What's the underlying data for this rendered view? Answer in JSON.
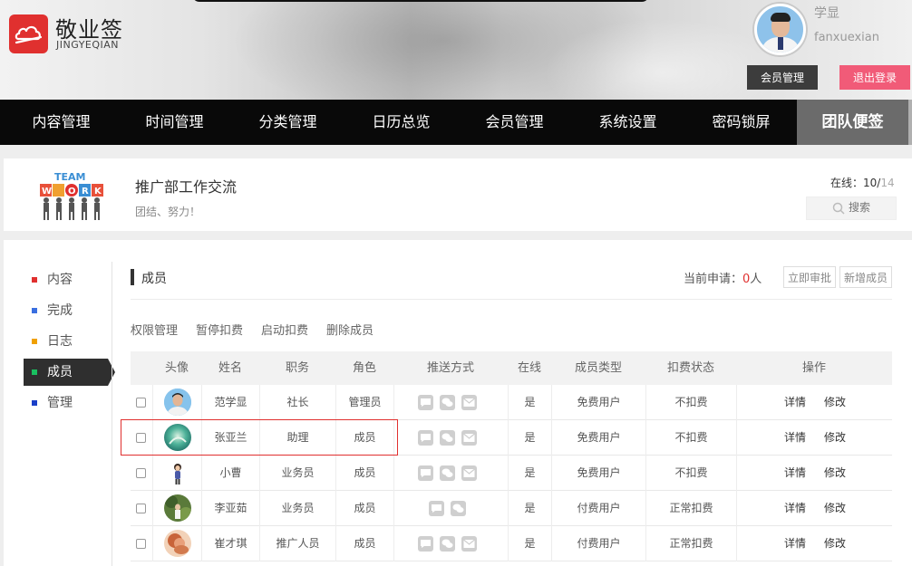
{
  "brand": {
    "name": "敬业签",
    "sub": "JINGYEQIAN"
  },
  "user": {
    "name": "学显",
    "id": "fanxuexian",
    "member_btn": "会员管理",
    "logout_btn": "退出登录"
  },
  "nav": [
    "内容管理",
    "时间管理",
    "分类管理",
    "日历总览",
    "会员管理",
    "系统设置",
    "密码锁屏",
    "团队便签"
  ],
  "team": {
    "logo_text": "TEAM WORK",
    "title": "推广部工作交流",
    "slogan": "团结、努力！",
    "online_label": "在线：",
    "online_count": "10/",
    "online_total": "14",
    "search_placeholder": "搜索"
  },
  "sidebar": [
    {
      "label": "内容",
      "color": "#e0302f"
    },
    {
      "label": "完成",
      "color": "#3a6fe0"
    },
    {
      "label": "日志",
      "color": "#f0a000"
    },
    {
      "label": "成员",
      "color": "#19c060"
    },
    {
      "label": "管理",
      "color": "#1a3fc8"
    }
  ],
  "section": {
    "title": "成员",
    "apply_label": "当前申请：",
    "apply_count": "0",
    "apply_unit": "人",
    "approve_btn": "立即审批",
    "add_btn": "新增成员"
  },
  "actions": [
    "权限管理",
    "暂停扣费",
    "启动扣费",
    "删除成员"
  ],
  "table": {
    "headers": [
      "头像",
      "姓名",
      "职务",
      "角色",
      "推送方式",
      "在线",
      "成员类型",
      "扣费状态",
      "操作"
    ],
    "op_detail": "详情",
    "op_edit": "修改",
    "rows": [
      {
        "name": "范学显",
        "title": "社长",
        "role": "管理员",
        "online": "是",
        "type": "免费用户",
        "billing": "不扣费"
      },
      {
        "name": "张亚兰",
        "title": "助理",
        "role": "成员",
        "online": "是",
        "type": "免费用户",
        "billing": "不扣费"
      },
      {
        "name": "小曹",
        "title": "业务员",
        "role": "成员",
        "online": "是",
        "type": "免费用户",
        "billing": "不扣费"
      },
      {
        "name": "李亚茹",
        "title": "业务员",
        "role": "成员",
        "online": "是",
        "type": "付费用户",
        "billing": "正常扣费"
      },
      {
        "name": "崔才琪",
        "title": "推广人员",
        "role": "成员",
        "online": "是",
        "type": "付费用户",
        "billing": "正常扣费"
      }
    ]
  }
}
